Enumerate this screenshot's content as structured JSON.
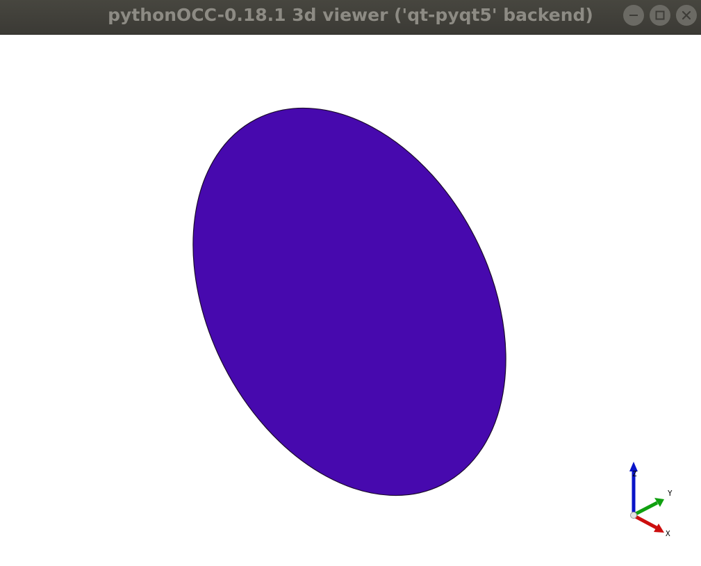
{
  "window": {
    "title": "pythonOCC-0.18.1 3d viewer ('qt-pyqt5' backend)",
    "controls": [
      "minimize-icon",
      "maximize-icon",
      "close-icon"
    ]
  },
  "viewer": {
    "background": "#ffffff",
    "shape": {
      "kind": "elliptical face",
      "fill": "#4709ae",
      "edge": "#1a0a2a"
    },
    "triedron": {
      "labels": {
        "z": "Z",
        "y": "Y",
        "x": "X"
      },
      "colors": {
        "z": "#0a14c8",
        "y": "#10a010",
        "x": "#cc0e0e"
      }
    }
  }
}
